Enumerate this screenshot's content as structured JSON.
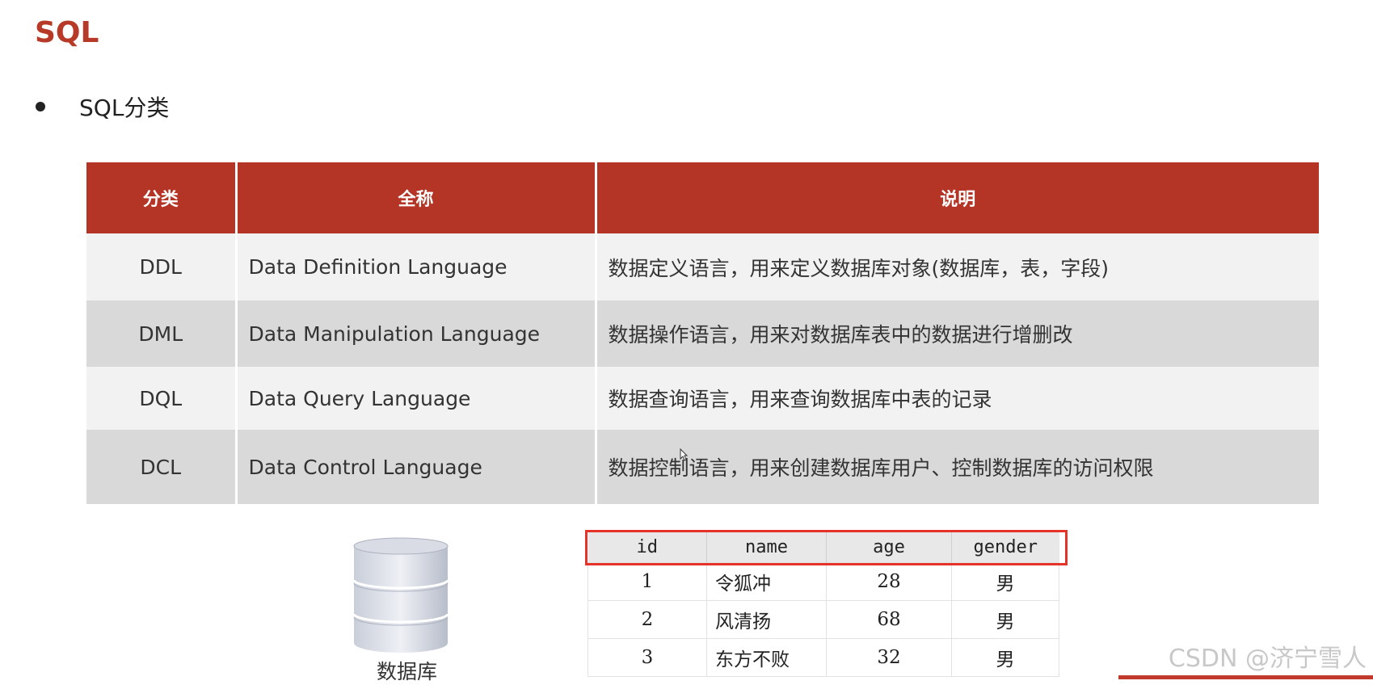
{
  "title": "SQL",
  "bullet": "SQL分类",
  "sql_table": {
    "headers": [
      "分类",
      "全称",
      "说明"
    ],
    "rows": [
      {
        "abbr": "DDL",
        "full": "Data Definition Language",
        "desc": "数据定义语言，用来定义数据库对象(数据库，表，字段)"
      },
      {
        "abbr": "DML",
        "full": "Data Manipulation Language",
        "desc": "数据操作语言，用来对数据库表中的数据进行增删改"
      },
      {
        "abbr": "DQL",
        "full": "Data Query Language",
        "desc": "数据查询语言，用来查询数据库中表的记录"
      },
      {
        "abbr": "DCL",
        "full": "Data Control Language",
        "desc": "数据控制语言，用来创建数据库用户、控制数据库的访问权限"
      }
    ]
  },
  "database_label": "数据库",
  "data_table": {
    "headers": [
      "id",
      "name",
      "age",
      "gender"
    ],
    "rows": [
      {
        "id": "1",
        "name": "令狐冲",
        "age": "28",
        "gender": "男"
      },
      {
        "id": "2",
        "name": "风清扬",
        "age": "68",
        "gender": "男"
      },
      {
        "id": "3",
        "name": "东方不败",
        "age": "32",
        "gender": "男"
      }
    ]
  },
  "watermark": "CSDN @济宁雪人",
  "colors": {
    "accent": "#b43425",
    "title": "#b63a27",
    "highlight": "#e53329"
  }
}
